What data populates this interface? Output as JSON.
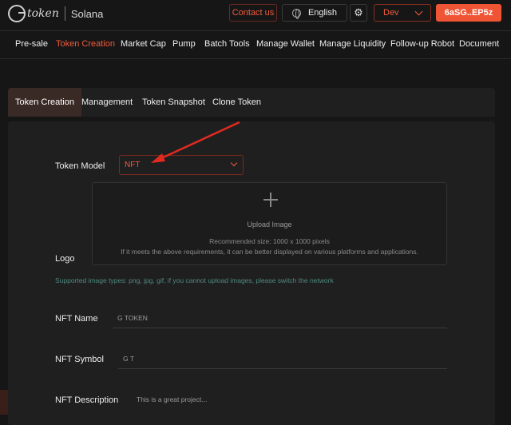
{
  "header": {
    "logo_text": "token",
    "chain": "Solana",
    "contact_label": "Contact us",
    "language": "English",
    "network": "Dev",
    "wallet": "6aSG..EP5z",
    "icons": {
      "logo": "g-token-logo",
      "globe": "globe-icon",
      "settings": "gear-icon",
      "dropdown": "chevron-down-icon"
    }
  },
  "nav": {
    "items": [
      "Pre-sale",
      "Token Creation",
      "Market Cap",
      "Pump",
      "Batch Tools",
      "Manage Wallet",
      "Manage Liquidity",
      "Follow-up Robot",
      "Document"
    ],
    "active": "Token Creation"
  },
  "tabs": {
    "items": [
      "Token Creation",
      "Management",
      "Token Snapshot",
      "Clone Token"
    ],
    "active": "Token Creation"
  },
  "form": {
    "token_model_label": "Token Model",
    "token_model_value": "NFT",
    "logo_label": "Logo",
    "upload_title": "Upload Image",
    "upload_size": "Recommended size: 1000 x 1000 pixels",
    "upload_note": "If it meets the above requirements, it can be better displayed on various platforms and applications.",
    "upload_hint": "Supported image types: png, jpg, gif, if you cannot upload images, please switch the network",
    "nft_name_label": "NFT Name",
    "nft_name_placeholder": "G TOKEN",
    "nft_symbol_label": "NFT Symbol",
    "nft_symbol_placeholder": "G T",
    "nft_description_label": "NFT Description",
    "nft_description_placeholder": "This is a great project..."
  },
  "colors": {
    "accent": "#f25a3d",
    "background": "#161616",
    "panel": "#1f1f1f",
    "hint": "#4f8a80",
    "annotation_arrow": "#e02a20"
  }
}
